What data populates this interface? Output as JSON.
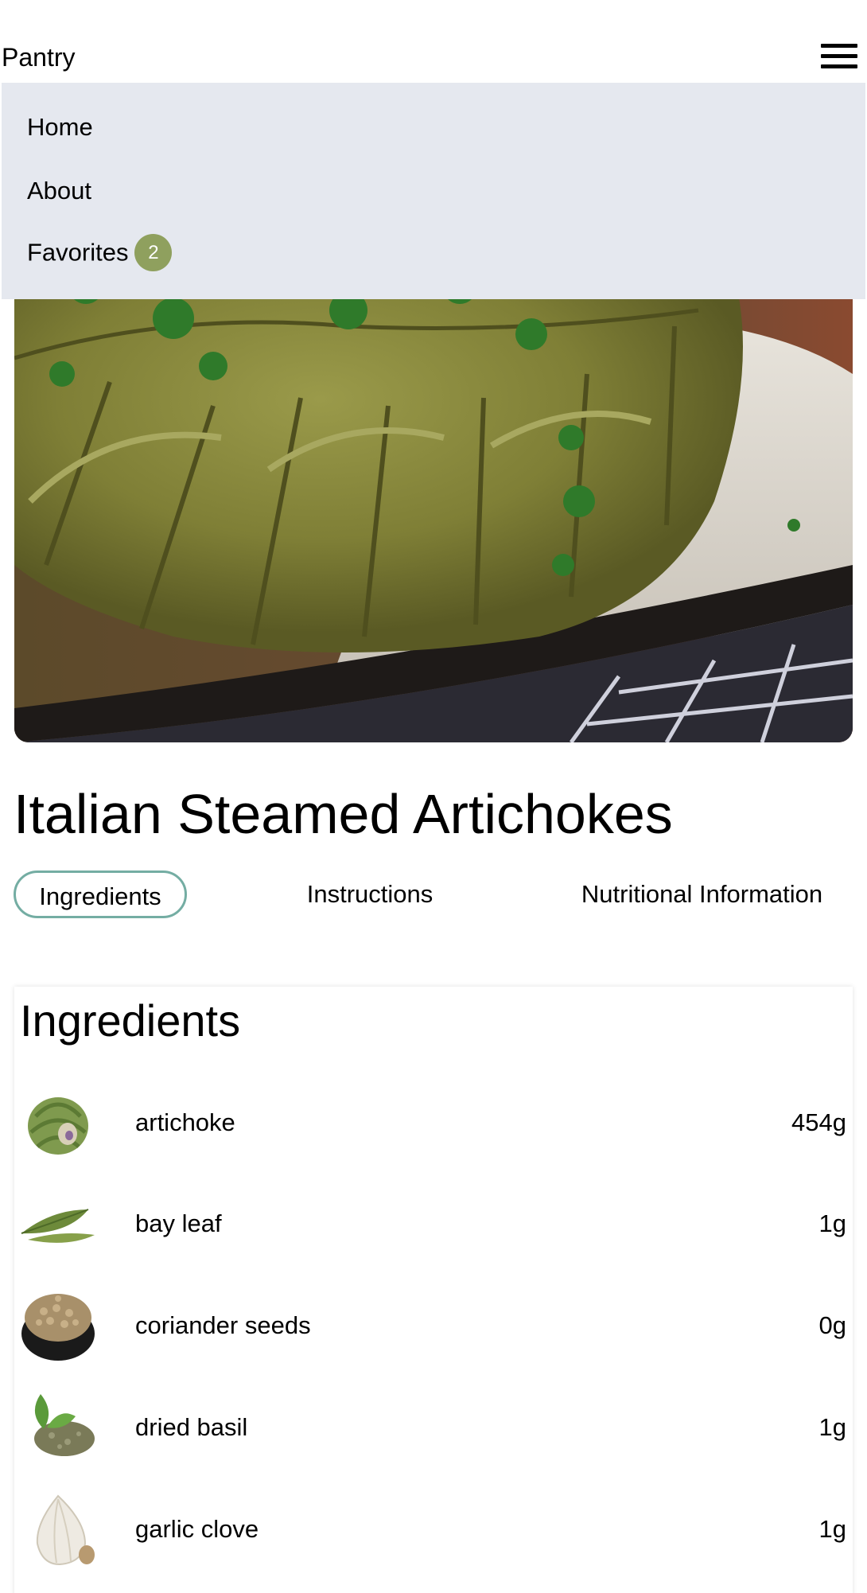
{
  "header": {
    "brand": "Pantry",
    "menu_icon": "hamburger-menu-icon"
  },
  "nav": {
    "items": [
      {
        "label": "Home"
      },
      {
        "label": "About"
      },
      {
        "label": "Favorites",
        "badge": "2"
      }
    ],
    "background": "#e5e8ef",
    "badge_color": "#8fa05e"
  },
  "recipe": {
    "image": "artichoke-dish-photo",
    "title": "Italian Steamed Artichokes"
  },
  "tabs": [
    {
      "label": "Ingredients",
      "active": true
    },
    {
      "label": "Instructions",
      "active": false
    },
    {
      "label": "Nutritional Information",
      "active": false
    }
  ],
  "tab_active_border": "#74ada3",
  "ingredients": {
    "heading": "Ingredients",
    "items": [
      {
        "name": "artichoke",
        "amount": "454g",
        "icon": "artichoke-image"
      },
      {
        "name": "bay leaf",
        "amount": "1g",
        "icon": "bay-leaf-image"
      },
      {
        "name": "coriander seeds",
        "amount": "0g",
        "icon": "coriander-seeds-image"
      },
      {
        "name": "dried basil",
        "amount": "1g",
        "icon": "dried-basil-image"
      },
      {
        "name": "garlic clove",
        "amount": "1g",
        "icon": "garlic-clove-image"
      }
    ]
  }
}
